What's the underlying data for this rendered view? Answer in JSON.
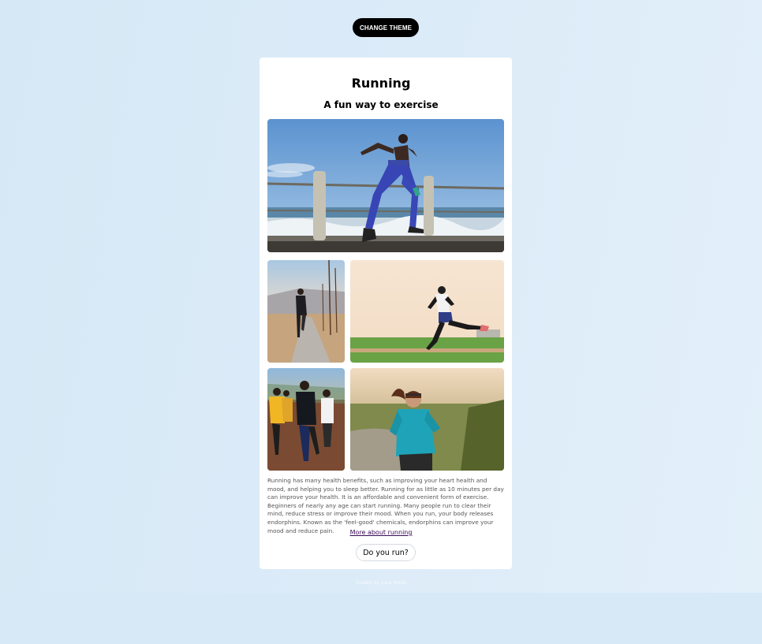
{
  "header": {
    "theme_button_label": "CHANGE THEME"
  },
  "card": {
    "title": "Running",
    "subtitle": "A fun way to exercise",
    "body": "Running has many health benefits, such as improving your heart health and mood, and helping you to sleep better. Running for as little as 10 minutes per day can improve your health. It is an affordable and convenient form of exercise. Beginners of nearly any age can start running. Many people run to clear their mind, reduce stress or improve their mood. When you run, your body releases endorphins. Known as the 'feel-good' chemicals, endorphins can improve your mood and reduce pain.",
    "link_label": "More about running",
    "button_label": "Do you run?"
  },
  "footer": {
    "text": "Coded by Lisa Wells"
  },
  "colors": {
    "page_background": "#dcebf8",
    "card_background": "#ffffff",
    "theme_button": "#000000",
    "link": "#3a0a5a"
  }
}
